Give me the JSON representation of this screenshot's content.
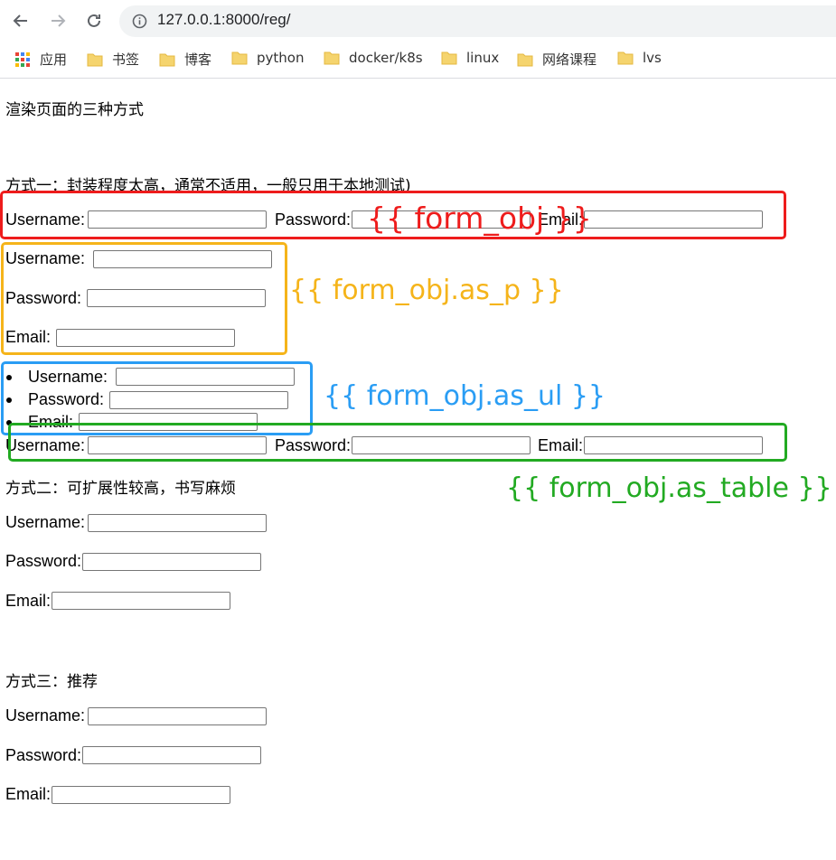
{
  "browser": {
    "url": "127.0.0.1:8000/reg/",
    "bookmarks": [
      "应用",
      "书签",
      "博客",
      "python",
      "docker/k8s",
      "linux",
      "网络课程",
      "lvs"
    ]
  },
  "page": {
    "heading": "渲染页面的三种方式",
    "method1": "方式一：封装程度太高，通常不适用，一般只用于本地测试)",
    "method2": "方式二：可扩展性较高，书写麻烦",
    "method3": "方式三：推荐",
    "labels": {
      "username": "Username:",
      "password": "Password:",
      "email": "Email:"
    }
  },
  "annotations": {
    "form_obj": "{{ form_obj }}",
    "as_p": "{{ form_obj.as_p }}",
    "as_ul": "{{ form_obj.as_ul }}",
    "as_table": "{{ form_obj.as_table }}"
  },
  "colors": {
    "red": "#ee1c1c",
    "orange": "#f5b41a",
    "blue": "#2a9df4",
    "green": "#22aa22"
  }
}
